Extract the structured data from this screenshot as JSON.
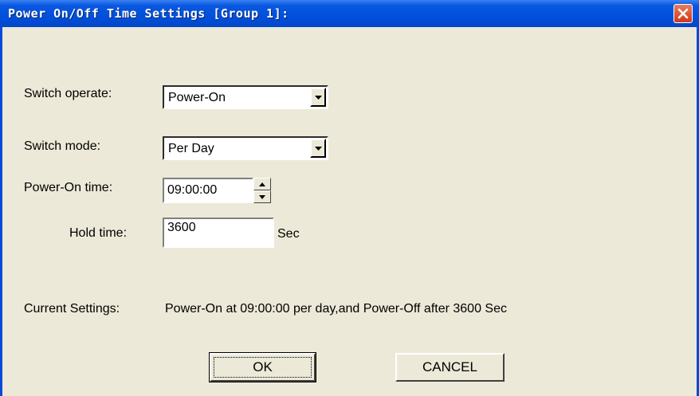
{
  "window": {
    "title": "Power On/Off Time Settings [Group 1]:"
  },
  "form": {
    "switch_operate_label": "Switch operate:",
    "switch_operate_value": "Power-On",
    "switch_mode_label": "Switch  mode:",
    "switch_mode_value": "Per Day",
    "power_on_time_label": "Power-On time:",
    "power_on_time_value": "09:00:00",
    "hold_time_label": "Hold time:",
    "hold_time_value": "3600",
    "hold_time_unit": "Sec"
  },
  "summary": {
    "label": "Current Settings:",
    "text": "Power-On at 09:00:00 per day,and Power-Off after 3600 Sec"
  },
  "buttons": {
    "ok": "OK",
    "cancel": "CANCEL"
  },
  "icons": {
    "close": "close-icon",
    "dropdown": "chevron-down-icon",
    "spin_up": "arrow-up-icon",
    "spin_down": "arrow-down-icon"
  },
  "colors": {
    "title_bar": "#0050dc",
    "dialog_bg": "#ece9d8",
    "close_button": "#cc3a17"
  }
}
